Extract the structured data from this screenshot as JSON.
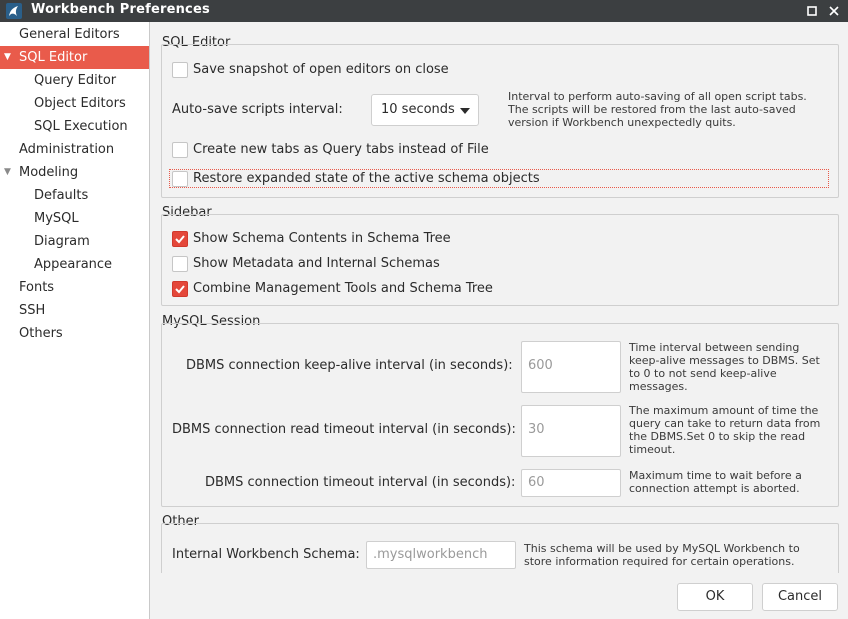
{
  "window": {
    "title": "Workbench Preferences"
  },
  "sidebar": {
    "items": [
      {
        "label": "General Editors"
      },
      {
        "label": "SQL Editor"
      },
      {
        "label": "Query Editor"
      },
      {
        "label": "Object Editors"
      },
      {
        "label": "SQL Execution"
      },
      {
        "label": "Administration"
      },
      {
        "label": "Modeling"
      },
      {
        "label": "Defaults"
      },
      {
        "label": "MySQL"
      },
      {
        "label": "Diagram"
      },
      {
        "label": "Appearance"
      },
      {
        "label": "Fonts"
      },
      {
        "label": "SSH"
      },
      {
        "label": "Others"
      }
    ]
  },
  "sql_editor": {
    "title": "SQL Editor",
    "save_snapshot": "Save snapshot of open editors on close",
    "autosave_label": "Auto-save scripts interval:",
    "autosave_value": "10 seconds",
    "autosave_help": "Interval to perform auto-saving of all open script tabs. The scripts will be restored from the last auto-saved version if Workbench unexpectedly quits.",
    "new_tabs": "Create new tabs as Query tabs instead of File",
    "restore_state": "Restore expanded state of the active schema objects"
  },
  "sidebar_section": {
    "title": "Sidebar",
    "show_schema_contents": "Show Schema Contents in Schema Tree",
    "show_metadata": "Show Metadata and Internal Schemas",
    "combine_tools": "Combine Management Tools and Schema Tree"
  },
  "session": {
    "title": "MySQL Session",
    "keepalive_label": "DBMS connection keep-alive interval (in seconds):",
    "keepalive_value": "600",
    "keepalive_help": "Time interval between sending keep-alive messages to DBMS. Set to 0 to not send keep-alive messages.",
    "read_timeout_label": "DBMS connection read timeout interval (in seconds):",
    "read_timeout_value": "30",
    "read_timeout_help": "The maximum amount of time the query can take to return data from the DBMS.Set 0 to skip the read timeout.",
    "conn_timeout_label": "DBMS connection timeout interval (in seconds):",
    "conn_timeout_value": "60",
    "conn_timeout_help": "Maximum time to wait before a connection attempt is aborted."
  },
  "other": {
    "title": "Other",
    "schema_label": "Internal Workbench Schema:",
    "schema_value": ".mysqlworkbench",
    "schema_help": "This schema will be used by MySQL Workbench to store information required for certain operations."
  },
  "buttons": {
    "ok": "OK",
    "cancel": "Cancel"
  },
  "colors": {
    "accent": "#e95b4b",
    "titlebar": "#3c3f41"
  }
}
